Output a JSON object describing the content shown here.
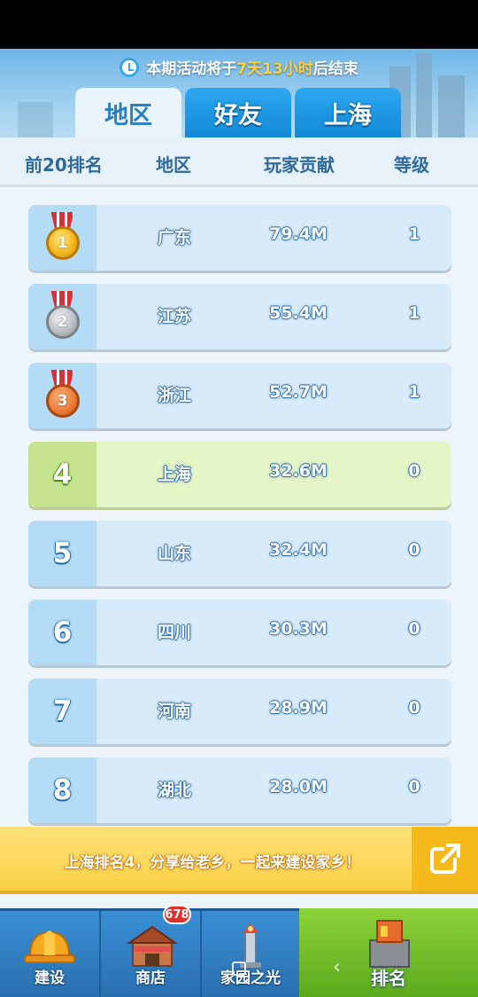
{
  "notice": {
    "prefix": "本期活动将于",
    "days": "7天",
    "hours": "13小时",
    "suffix": "后结束"
  },
  "tabs": [
    {
      "label": "地区",
      "active": true
    },
    {
      "label": "好友",
      "active": false
    },
    {
      "label": "上海",
      "active": false
    }
  ],
  "columns": {
    "rank": "前20排名",
    "region": "地区",
    "contribution": "玩家贡献",
    "level": "等级"
  },
  "rows": [
    {
      "rank": "1",
      "region": "广东",
      "contribution": "79.4M",
      "level": "1",
      "medal": "gold"
    },
    {
      "rank": "2",
      "region": "江苏",
      "contribution": "55.4M",
      "level": "1",
      "medal": "silver"
    },
    {
      "rank": "3",
      "region": "浙江",
      "contribution": "52.7M",
      "level": "1",
      "medal": "bronze"
    },
    {
      "rank": "4",
      "region": "上海",
      "contribution": "32.6M",
      "level": "0",
      "highlight": true
    },
    {
      "rank": "5",
      "region": "山东",
      "contribution": "32.4M",
      "level": "0"
    },
    {
      "rank": "6",
      "region": "四川",
      "contribution": "30.3M",
      "level": "0"
    },
    {
      "rank": "7",
      "region": "河南",
      "contribution": "28.9M",
      "level": "0"
    },
    {
      "rank": "8",
      "region": "湖北",
      "contribution": "28.0M",
      "level": "0"
    }
  ],
  "share": {
    "text": "上海排名4，分享给老乡，一起来建设家乡！",
    "icon": "share-external-icon"
  },
  "nav": {
    "build": "建设",
    "shop": "商店",
    "shop_badge": "678",
    "home_light": "家园之光",
    "ranking": "排名"
  },
  "colors": {
    "accent": "#2a7fc0",
    "highlight_row": "#e4f5c6",
    "share_bar": "#fbd044",
    "active_nav": "#5aaa1c"
  }
}
